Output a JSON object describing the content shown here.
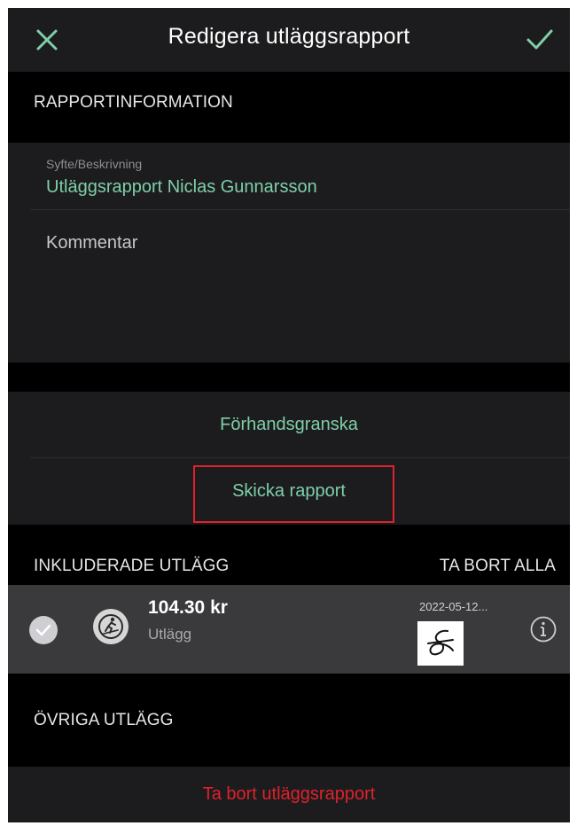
{
  "header": {
    "title": "Redigera utläggsrapport",
    "close_icon": "close-icon",
    "confirm_icon": "checkmark-icon"
  },
  "sections": {
    "report_info": "RAPPORTINFORMATION",
    "included": "INKLUDERADE UTLÄGG",
    "remove_all": "TA BORT ALLA",
    "other": "ÖVRIGA UTLÄGG"
  },
  "form": {
    "purpose_label": "Syfte/Beskrivning",
    "purpose_value": "Utläggsrapport Niclas Gunnarsson",
    "comment_placeholder": "Kommentar"
  },
  "actions": {
    "preview": "Förhandsgranska",
    "send": "Skicka rapport"
  },
  "expense": {
    "amount": "104.30 kr",
    "type": "Utlägg",
    "date": "2022-05-12...",
    "category_icon": "cross-country-skiing-icon",
    "selected": true
  },
  "delete_report": "Ta bort utläggsrapport",
  "colors": {
    "accent": "#7fcfa9",
    "danger": "#e0212b",
    "background": "#000000",
    "panel": "#1c1c1e",
    "row": "#3a3a3c"
  }
}
